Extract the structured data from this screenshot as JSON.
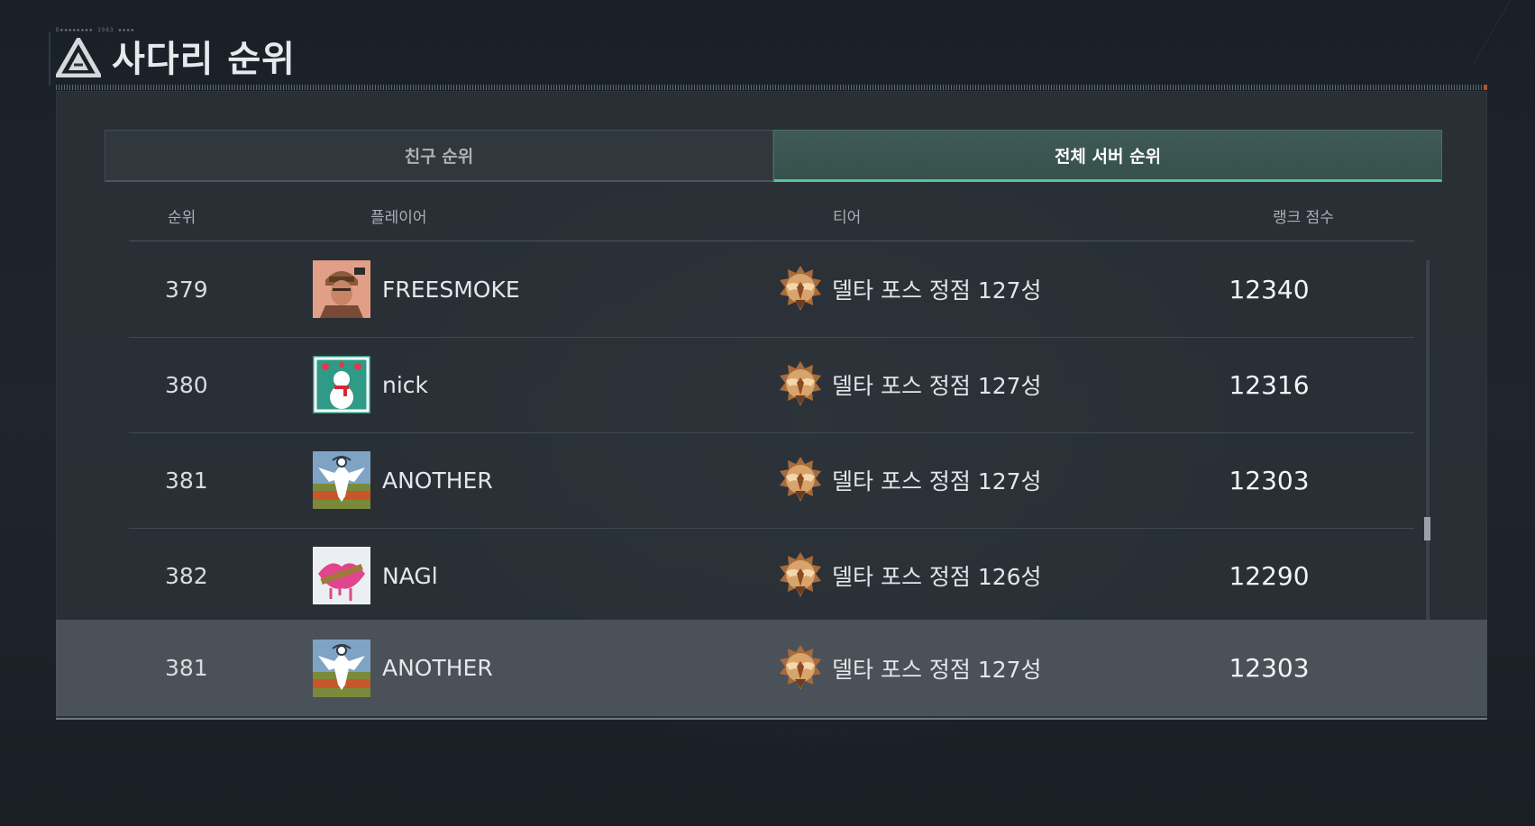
{
  "header": {
    "small_text": "D▪▪▪▪▪▪▪▪ 1983 ▪▪▪▪",
    "title": "사다리 순위"
  },
  "tabs": [
    {
      "label": "친구 순위",
      "active": false
    },
    {
      "label": "전체 서버 순위",
      "active": true
    }
  ],
  "columns": {
    "rank": "순위",
    "player": "플레이어",
    "tier": "티어",
    "score": "랭크 점수"
  },
  "rows": [
    {
      "rank": "379",
      "player": "FREESMOKE",
      "avatar": "soldier-avatar-icon",
      "tier": "델타 포스 정점 127성",
      "score": "12340"
    },
    {
      "rank": "380",
      "player": "nick",
      "avatar": "snowman-avatar-icon",
      "tier": "델타 포스 정점 127성",
      "score": "12316"
    },
    {
      "rank": "381",
      "player": "ANOTHER",
      "avatar": "eagle-emblem-avatar-icon",
      "tier": "델타 포스 정점 127성",
      "score": "12303"
    },
    {
      "rank": "382",
      "player": "NAGl",
      "avatar": "lips-avatar-icon",
      "tier": "델타 포스 정점 126성",
      "score": "12290"
    }
  ],
  "self_row": {
    "rank": "381",
    "player": "ANOTHER",
    "avatar": "eagle-emblem-avatar-icon",
    "tier": "델타 포스 정점 127성",
    "score": "12303"
  },
  "tier_icon": "apex-eagle-badge-icon",
  "colors": {
    "accent": "#54c2a0",
    "panel": "#2c3238",
    "self_row": "#4a5158",
    "badge_gold": "#c9955a"
  }
}
